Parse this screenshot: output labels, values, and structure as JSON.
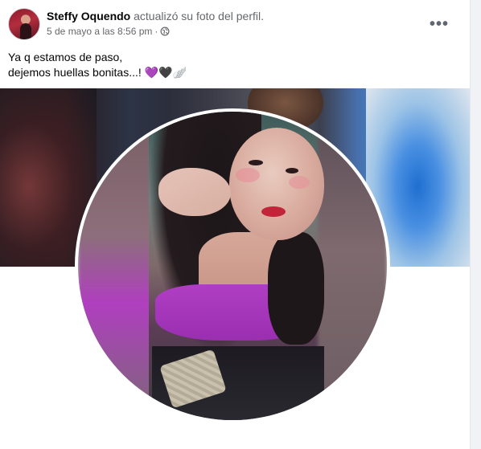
{
  "post": {
    "author": "Steffy Oquendo",
    "action": "actualizó su foto del perfil.",
    "timestamp": "5 de mayo a las 8:56 pm",
    "separator": "·",
    "privacy_icon": "globe-icon",
    "more_icon": "more-options-icon",
    "more_label": "•••",
    "caption_line1": "Ya q estamos de paso,",
    "caption_line2": "dejemos huellas bonitas...!",
    "caption_emojis": "💜🖤🪽"
  },
  "colors": {
    "text_primary": "#050505",
    "text_secondary": "#65676b",
    "card_bg": "#ffffff",
    "page_bg": "#f0f2f5"
  }
}
